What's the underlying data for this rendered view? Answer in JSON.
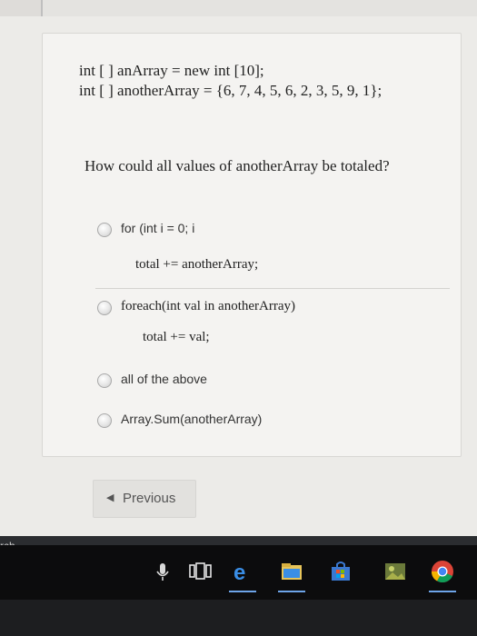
{
  "question": {
    "code_lines": [
      "int [ ] anArray = new int [10];",
      "int [ ] anotherArray = {6, 7, 4, 5, 6, 2, 3, 5, 9, 1};"
    ],
    "prompt": "How could all values of anotherArray be totaled?"
  },
  "options": [
    {
      "label": "for (int i = 0; i",
      "sub": "total += anotherArray;"
    },
    {
      "label": "foreach(int val in anotherArray)",
      "sub": "total += val;"
    },
    {
      "label": "all of the above"
    },
    {
      "label": "Array.Sum(anotherArray)"
    }
  ],
  "nav": {
    "previous_label": "Previous"
  },
  "taskbar": {
    "search_fragment": "rch",
    "icons": [
      "microphone-icon",
      "task-view-icon",
      "edge-icon",
      "file-explorer-icon",
      "store-icon",
      "photos-icon",
      "chrome-icon"
    ]
  }
}
